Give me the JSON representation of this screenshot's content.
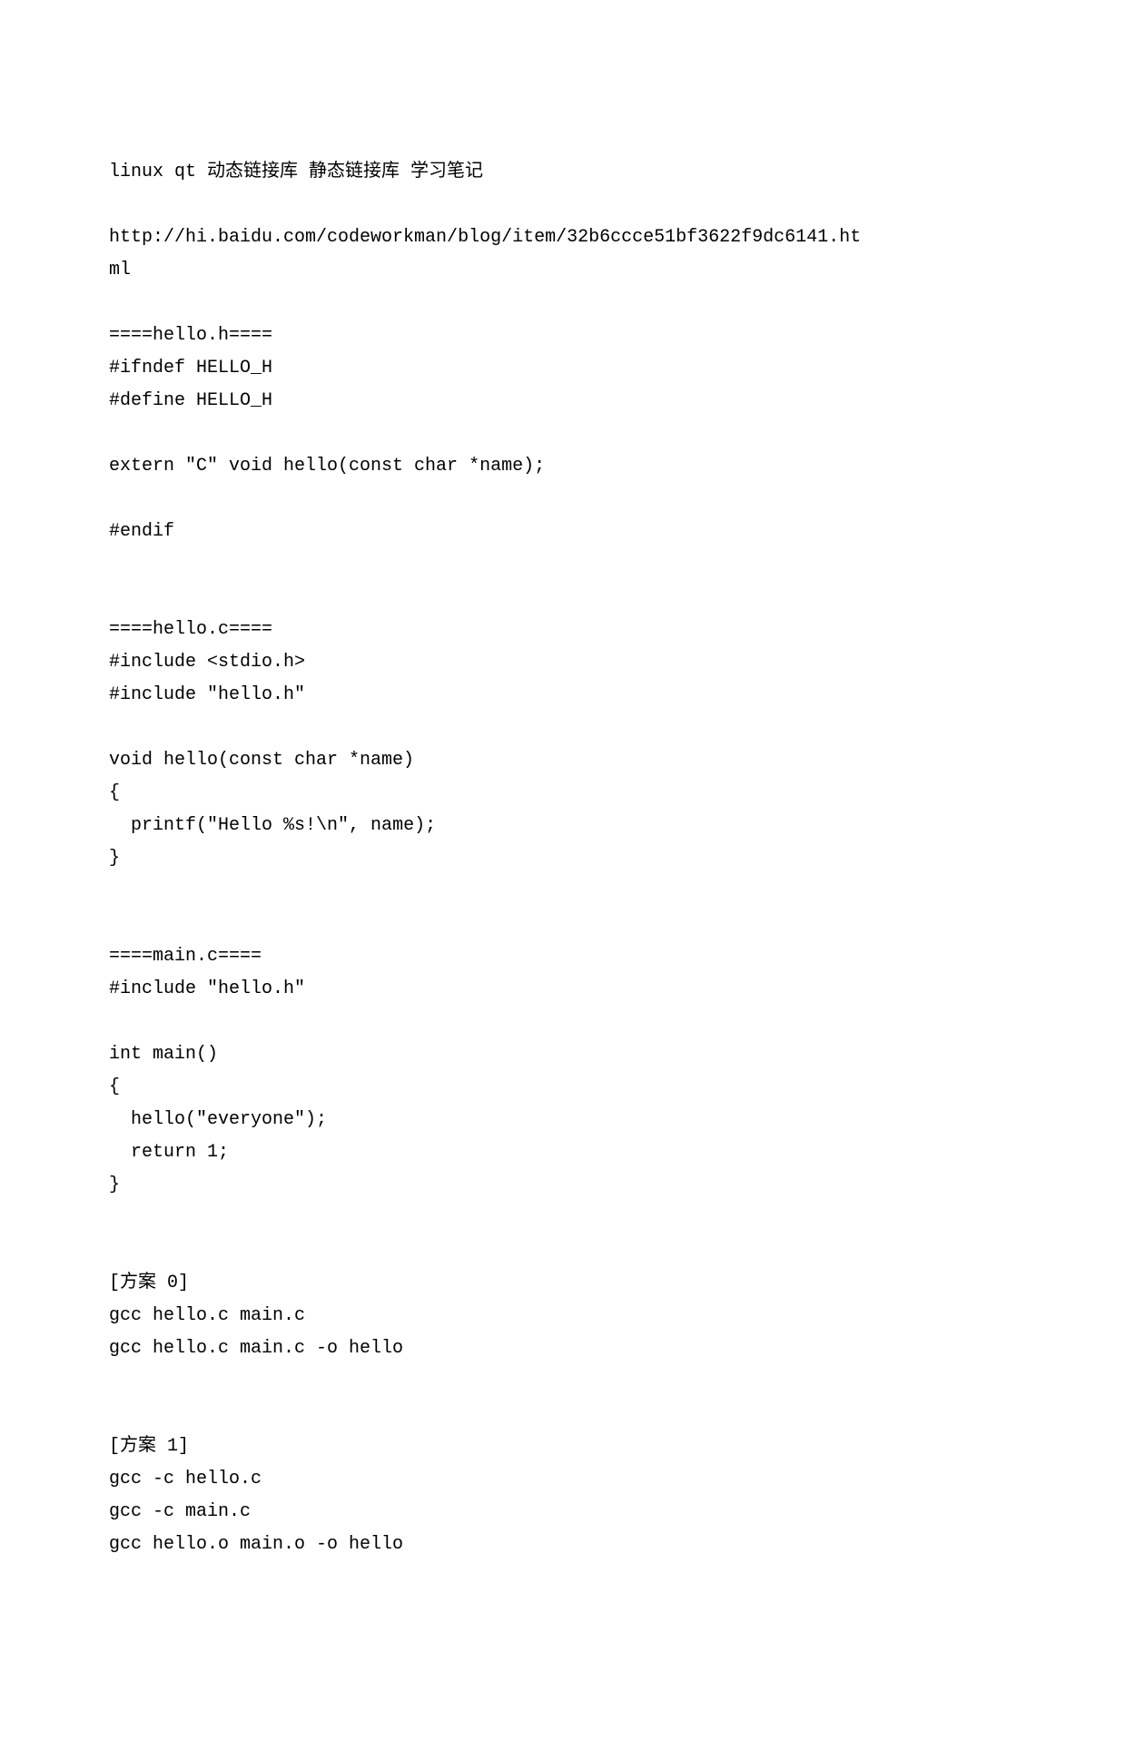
{
  "lines": [
    "linux qt 动态链接库 静态链接库 学习笔记",
    "",
    "http://hi.baidu.com/codeworkman/blog/item/32b6ccce51bf3622f9dc6141.ht",
    "ml",
    "",
    "====hello.h====",
    "#ifndef HELLO_H",
    "#define HELLO_H",
    "",
    "extern \"C\" void hello(const char *name);",
    "",
    "#endif",
    "",
    "",
    "====hello.c====",
    "#include <stdio.h>",
    "#include \"hello.h\"",
    "",
    "void hello(const char *name)",
    "{",
    "  printf(\"Hello %s!\\n\", name);",
    "}",
    "",
    "",
    "====main.c====",
    "#include \"hello.h\"",
    "",
    "int main()",
    "{",
    "  hello(\"everyone\");",
    "  return 1;",
    "}",
    "",
    "",
    "[方案 0]",
    "gcc hello.c main.c",
    "gcc hello.c main.c -o hello",
    "",
    "",
    "[方案 1]",
    "gcc -c hello.c",
    "gcc -c main.c",
    "gcc hello.o main.o -o hello"
  ]
}
